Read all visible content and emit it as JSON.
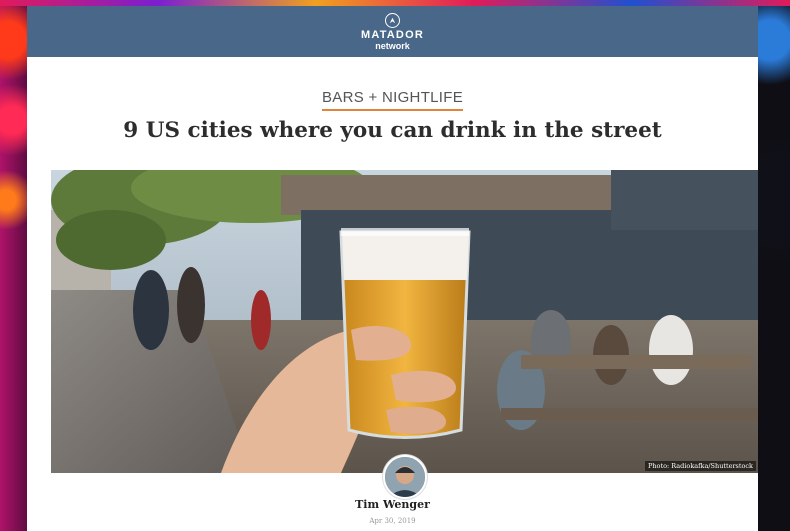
{
  "site": {
    "logo_line1": "MATADOR",
    "logo_line2": "network",
    "logo_icon": "compass-icon",
    "header_color": "#496789"
  },
  "article": {
    "category": "BARS + NIGHTLIFE",
    "category_accent": "#e0843b",
    "title": "9 US cities where you can drink in the street",
    "image_credit": "Photo: Radiokafka/Shutterstock",
    "author": "Tim Wenger",
    "date": "Apr 30, 2019"
  }
}
